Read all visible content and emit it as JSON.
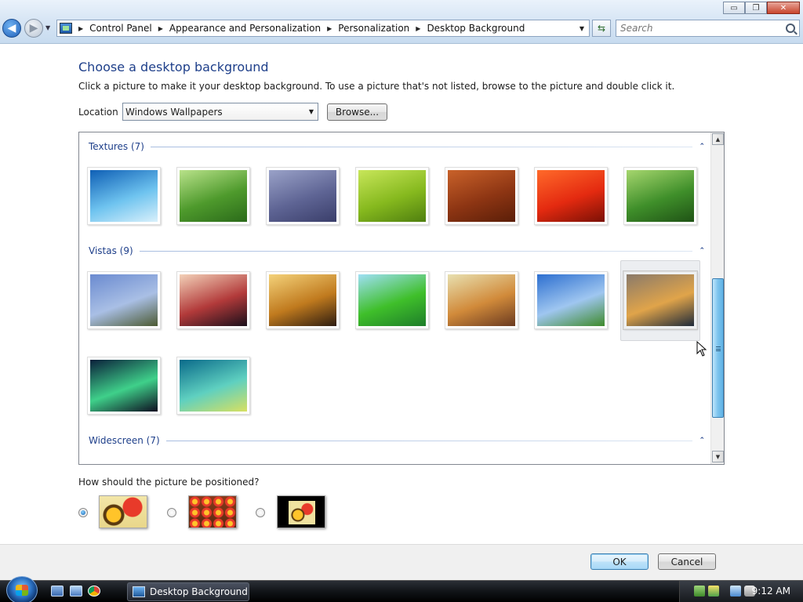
{
  "window": {
    "buttons": {
      "minimize": "▭",
      "maximize": "❐",
      "close": "✕"
    }
  },
  "address": {
    "breadcrumbs": [
      "Control Panel",
      "Appearance and Personalization",
      "Personalization",
      "Desktop Background"
    ],
    "search_placeholder": "Search"
  },
  "main": {
    "title": "Choose a desktop background",
    "description": "Click a picture to make it your desktop background. To use a picture that's not listed, browse to the picture and double click it.",
    "location_label": "Location",
    "location_value": "Windows Wallpapers",
    "browse_label": "Browse..."
  },
  "gallery": {
    "groups": [
      {
        "name": "Textures (7)",
        "collapse": "⌃"
      },
      {
        "name": "Vistas (9)",
        "collapse": "⌃"
      },
      {
        "name": "Widescreen (7)",
        "collapse": "⌃"
      }
    ],
    "textures": [
      {
        "icon": "underwater-fish",
        "colors": [
          "#0f5fb5",
          "#6ec3ef",
          "#d9f0fb"
        ]
      },
      {
        "icon": "green-grass",
        "colors": [
          "#b9e28a",
          "#4e9a2c",
          "#2b6a1a"
        ]
      },
      {
        "icon": "pebbles",
        "colors": [
          "#9aa2c8",
          "#5e6494",
          "#3a3e6a"
        ]
      },
      {
        "icon": "green-leaf",
        "colors": [
          "#c8e65a",
          "#86b91e",
          "#4f7f0f"
        ]
      },
      {
        "icon": "wood-grain",
        "colors": [
          "#c9622a",
          "#8d3513",
          "#5a1e08"
        ]
      },
      {
        "icon": "red-flower",
        "colors": [
          "#ff6a2a",
          "#e42a10",
          "#7a1005"
        ]
      },
      {
        "icon": "bamboo",
        "colors": [
          "#a6d66e",
          "#3f8f2a",
          "#1f5215"
        ]
      }
    ],
    "vistas": [
      {
        "icon": "karst-river",
        "colors": [
          "#6a8ad0",
          "#a9bfe5",
          "#4c5a32"
        ]
      },
      {
        "icon": "sunset-silhouette",
        "colors": [
          "#f3d1b8",
          "#b23a3a",
          "#1a0f1a"
        ]
      },
      {
        "icon": "beach-rocks-sunset",
        "colors": [
          "#f4d27a",
          "#c07a1e",
          "#2d1c10"
        ]
      },
      {
        "icon": "palm-frond",
        "colors": [
          "#9fe0f5",
          "#3fbf2a",
          "#1e7d2a"
        ]
      },
      {
        "icon": "grassland-sunrise",
        "colors": [
          "#e8e0b0",
          "#d18a3a",
          "#6a3a20"
        ]
      },
      {
        "icon": "green-hills",
        "colors": [
          "#2d6fd0",
          "#9fc6f0",
          "#3e8a2a"
        ]
      },
      {
        "icon": "mountain-lake",
        "colors": [
          "#8a7a6a",
          "#e0a44a",
          "#1e2a3a"
        ]
      }
    ],
    "vistas_row2": [
      {
        "icon": "aurora",
        "colors": [
          "#0a1f3a",
          "#3fd08a",
          "#0d0d20"
        ]
      },
      {
        "icon": "vista-aurora",
        "colors": [
          "#0a6a8a",
          "#5fd0c0",
          "#d8e060"
        ]
      }
    ]
  },
  "position": {
    "question": "How should the picture be positioned?",
    "options": [
      {
        "name": "fit-to-screen",
        "checked": true
      },
      {
        "name": "tile",
        "checked": false
      },
      {
        "name": "center",
        "checked": false
      }
    ]
  },
  "footer": {
    "ok_label": "OK",
    "cancel_label": "Cancel"
  },
  "taskbar": {
    "task_label": "Desktop Background",
    "clock": "9:12 AM"
  }
}
